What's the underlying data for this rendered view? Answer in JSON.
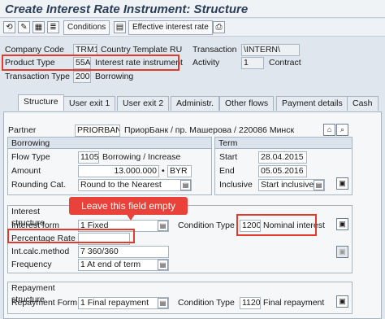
{
  "title": "Create Interest Rate Instrument: Structure",
  "toolbar": {
    "conditions": "Conditions",
    "effective_rate": "Effective interest rate"
  },
  "header": {
    "company_code_label": "Company Code",
    "company_code": "TRM1",
    "company_name": "Country Template RU",
    "transaction_label": "Transaction",
    "transaction": "\\INTERN\\",
    "product_type_label": "Product Type",
    "product_type": "55A",
    "product_name": "Interest rate instrument",
    "activity_label": "Activity",
    "activity": "1",
    "activity_name": "Contract",
    "transaction_type_label": "Transaction Type",
    "transaction_type": "200",
    "transaction_type_name": "Borrowing"
  },
  "tabs": [
    "Structure",
    "User exit 1",
    "User exit 2",
    "Administr.",
    "Other flows",
    "Payment details",
    "Cash"
  ],
  "partner": {
    "label": "Partner",
    "id": "PRIORBANK",
    "name": "ПриорБанк / пр. Машерова / 220086 Минск"
  },
  "borrowing": {
    "title": "Borrowing",
    "flow_type_label": "Flow Type",
    "flow_type": "1105",
    "flow_type_name": "Borrowing / Increase",
    "amount_label": "Amount",
    "amount": "13.000.000",
    "currency": "BYR",
    "rounding_label": "Rounding Cat.",
    "rounding": "Round to the Nearest"
  },
  "term": {
    "title": "Term",
    "start_label": "Start",
    "start": "28.04.2015",
    "end_label": "End",
    "end": "05.05.2016",
    "inclusive_label": "Inclusive",
    "inclusive": "Start inclusive"
  },
  "interest": {
    "title": "Interest structure",
    "form_label": "Interest form",
    "form": "1 Fixed",
    "condition_type_label": "Condition Type",
    "condition_type": "1200",
    "condition_type_name": "Nominal interest",
    "percentage_label": "Percentage Rate",
    "percentage": "",
    "calc_method_label": "Int.calc.method",
    "calc_method": "7 360/360",
    "frequency_label": "Frequency",
    "frequency": "1 At end of term"
  },
  "repayment": {
    "title": "Repayment structure",
    "form_label": "Repayment Form",
    "form": "1 Final repayment",
    "condition_type_label": "Condition Type",
    "condition_type": "1120",
    "condition_type_name": "Final repayment"
  },
  "callout": "Leave this field empty",
  "colors": {
    "highlight": "#e23b2e",
    "title": "#2b3e57"
  }
}
